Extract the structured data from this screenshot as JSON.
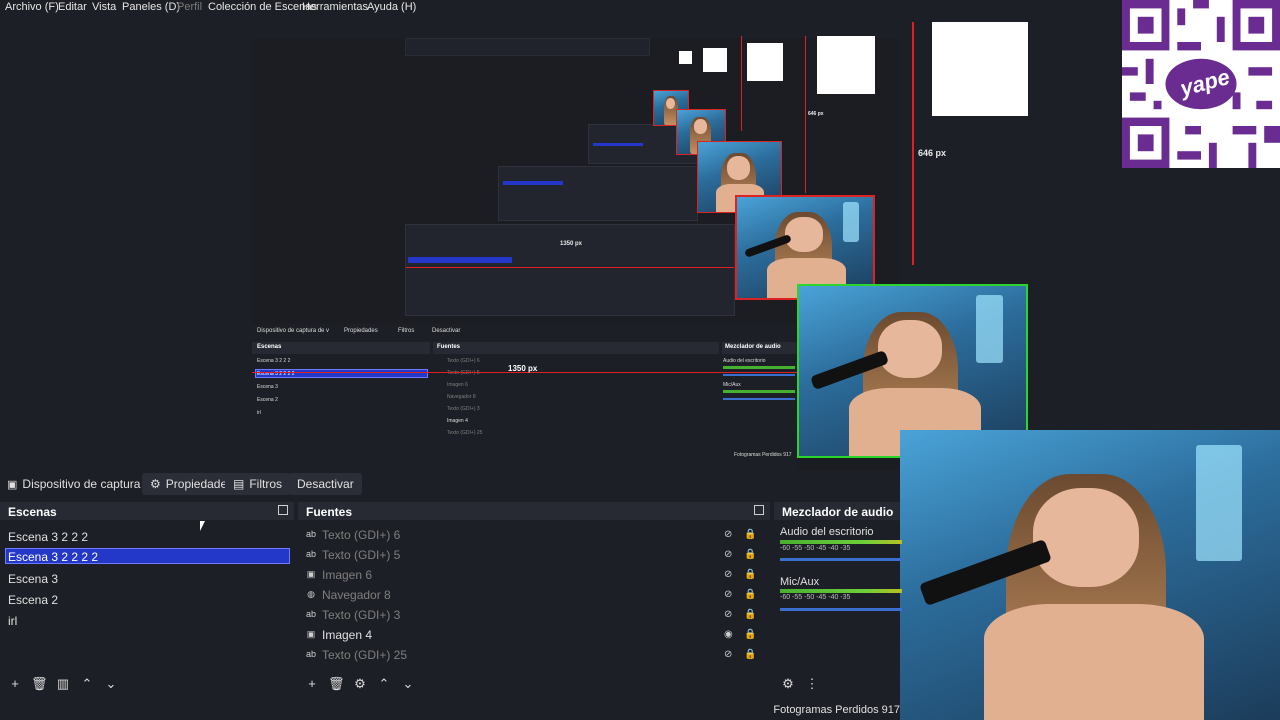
{
  "menu": {
    "items": [
      {
        "label": "Archivo (F)",
        "enabled": true
      },
      {
        "label": "Editar",
        "enabled": true
      },
      {
        "label": "Vista",
        "enabled": true
      },
      {
        "label": "Paneles (D)",
        "enabled": true
      },
      {
        "label": "Perfil",
        "enabled": false
      },
      {
        "label": "Colección de Escenas",
        "enabled": true
      },
      {
        "label": "Herramientas",
        "enabled": true
      },
      {
        "label": "Ayuda (H)",
        "enabled": true
      }
    ]
  },
  "preview": {
    "dim_labels": [
      "646 px",
      "1350 px",
      "1350 px",
      "646 px"
    ],
    "mini_preview": {
      "source_label": "Dispositivo de captura de v",
      "properties": "Propiedades",
      "filters": "Filtros",
      "deactivate": "Desactivar",
      "scenes_title": "Escenas",
      "sources_title": "Fuentes",
      "mixer_title": "Mezclador de audio",
      "scenes": [
        "Escena 3 2 2 2",
        "Escena 3 2 2 2 2",
        "Escena 3",
        "Escena 2",
        "irl"
      ],
      "sources": [
        "Texto (GDI+) 6",
        "Texto (GDI+) 5",
        "Imagen 6",
        "Navegador 8",
        "Texto (GDI+) 3",
        "Imagen 4",
        "Texto (GDI+) 25"
      ],
      "mixer_channels": [
        "Audio del escritorio",
        "Mic/Aux"
      ],
      "status": "Fotogramas Perdidos 917"
    },
    "qr_brand": "yape"
  },
  "toolbar": {
    "source_label": "Dispositivo de captura de v",
    "properties_label": "Propiedades",
    "filters_label": "Filtros",
    "deactivate_label": "Desactivar"
  },
  "scenes": {
    "title": "Escenas",
    "items": [
      {
        "label": "Escena 3 2 2 2",
        "selected": false
      },
      {
        "label": "Escena 3 2 2 2 2",
        "selected": true
      },
      {
        "label": "Escena 3",
        "selected": false
      },
      {
        "label": "Escena 2",
        "selected": false
      },
      {
        "label": "irl",
        "selected": false
      }
    ]
  },
  "sources": {
    "title": "Fuentes",
    "items": [
      {
        "label": "Texto (GDI+) 6",
        "icon": "text-icon",
        "visible": false
      },
      {
        "label": "Texto (GDI+) 5",
        "icon": "text-icon",
        "visible": false
      },
      {
        "label": "Imagen 6",
        "icon": "image-icon",
        "visible": false
      },
      {
        "label": "Navegador 8",
        "icon": "globe-icon",
        "visible": false
      },
      {
        "label": "Texto (GDI+) 3",
        "icon": "text-icon",
        "visible": false
      },
      {
        "label": "Imagen 4",
        "icon": "image-icon",
        "visible": true
      },
      {
        "label": "Texto (GDI+) 25",
        "icon": "text-icon",
        "visible": false
      }
    ]
  },
  "mixer": {
    "title": "Mezclador de audio",
    "channels": [
      {
        "label": "Audio del escritorio",
        "scale": "-60  -55  -50  -45  -40  -35"
      },
      {
        "label": "Mic/Aux",
        "scale": "-60  -55  -50  -45  -40  -35"
      }
    ]
  },
  "status": {
    "dropped_frames": "Fotogramas Perdidos 917"
  },
  "colors": {
    "selection": "#2337c8",
    "guide_red": "#e02020",
    "qr_purple": "#6a2c91"
  }
}
